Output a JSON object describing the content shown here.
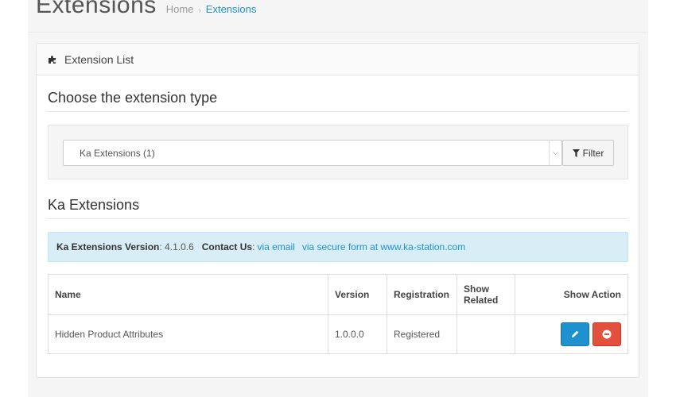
{
  "header": {
    "title": "Extensions",
    "breadcrumb": [
      {
        "label": "Home"
      },
      {
        "label": "Extensions"
      }
    ],
    "breadcrumb_separator": "›"
  },
  "panel": {
    "heading": "Extension List",
    "heading_icon": "puzzle-piece-icon"
  },
  "filter": {
    "section_title": "Choose the extension type",
    "selected": "Ka Extensions (1)",
    "button_label": "Filter"
  },
  "ka_section": {
    "title": "Ka Extensions",
    "info": {
      "version_label": "Ka Extensions Version",
      "version_value": ": 4.1.0.6",
      "contact_label": "Contact Us",
      "contact_sep": ":",
      "link_email": "via email",
      "link_form": "via secure form at www.ka-station.com"
    }
  },
  "table": {
    "headers": {
      "name": "Name",
      "version": "Version",
      "registration": "Registration",
      "show_related_1": "Show",
      "show_related_2": "Related",
      "show_action": "Show Action"
    },
    "rows": [
      {
        "name": "Hidden Product Attributes",
        "version": "1.0.0.0",
        "registration": "Registered",
        "related": ""
      }
    ]
  },
  "colors": {
    "primary": "#1e91cf",
    "danger": "#e3503e",
    "info_bg": "#d9edf7"
  }
}
